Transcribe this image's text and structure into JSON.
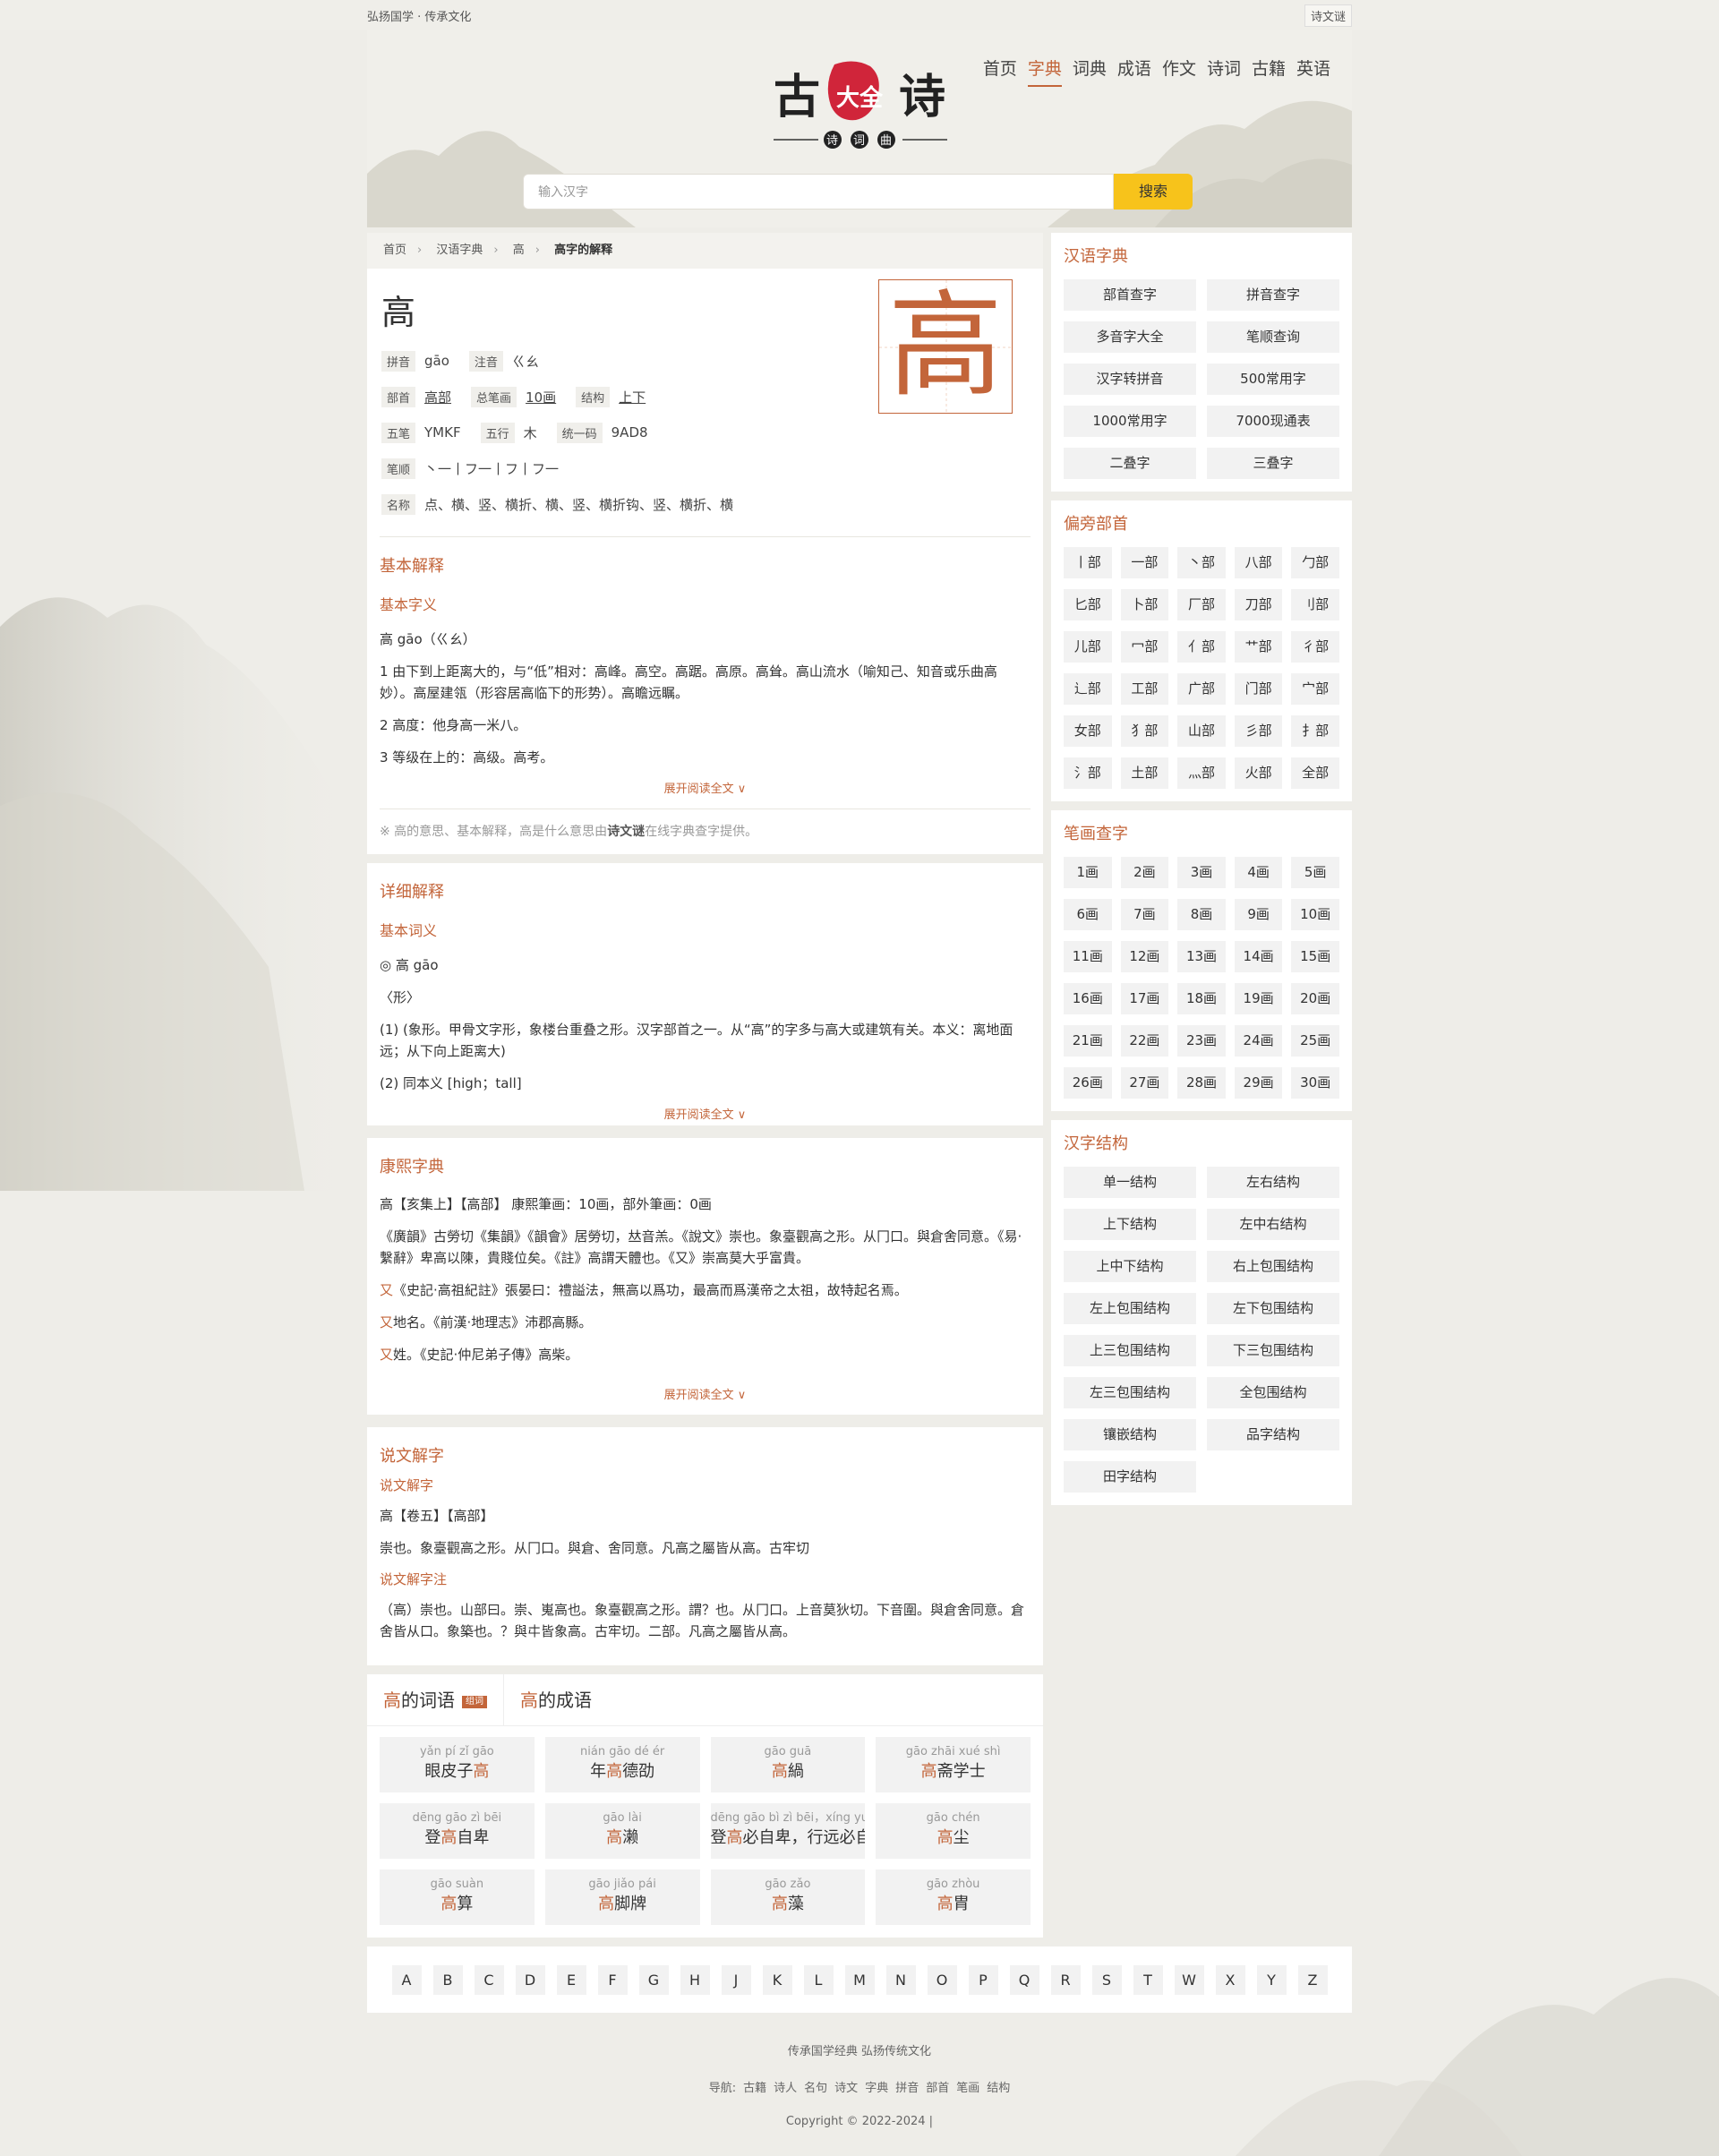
{
  "topbar": {
    "left": "弘扬国学 · 传承文化",
    "right": "诗文谜"
  },
  "nav": [
    "首页",
    "字典",
    "词典",
    "成语",
    "作文",
    "诗词",
    "古籍",
    "英语"
  ],
  "nav_active": 1,
  "logo": {
    "left": "古",
    "stamp": "大全",
    "right": "诗",
    "badges": [
      "诗",
      "词",
      "曲"
    ]
  },
  "search": {
    "placeholder": "输入汉字",
    "button": "搜索"
  },
  "breadcrumb": [
    "首页",
    "汉语字典",
    "高",
    "高字的解释"
  ],
  "char": {
    "glyph": "高",
    "rows": [
      [
        {
          "tag": "拼音",
          "val": "gāo"
        },
        {
          "tag": "注音",
          "val": "ㄍㄠ"
        }
      ],
      [
        {
          "tag": "部首",
          "val": "高部",
          "link": true
        },
        {
          "tag": "总笔画",
          "val": "10画",
          "link": true
        },
        {
          "tag": "结构",
          "val": "上下",
          "link": true
        }
      ],
      [
        {
          "tag": "五笔",
          "val": "YMKF"
        },
        {
          "tag": "五行",
          "val": "木"
        },
        {
          "tag": "统一码",
          "val": "9AD8"
        }
      ],
      [
        {
          "tag": "笔顺",
          "val": "丶一丨フ一丨フ丨フ一"
        }
      ],
      [
        {
          "tag": "名称",
          "val": "点、横、竖、横折、横、竖、横折钩、竖、横折、横"
        }
      ]
    ]
  },
  "basic": {
    "title": "基本解释",
    "subtitle": "基本字义",
    "head": "高 gāo（ㄍㄠ）",
    "items": [
      "1  由下到上距离大的，与“低”相对：高峰。高空。高踞。高原。高耸。高山流水（喻知己、知音或乐曲高妙）。高屋建瓴（形容居高临下的形势）。高瞻远瞩。",
      "2  高度：他身高一米八。",
      "3  等级在上的：高级。高考。"
    ],
    "more": "展开阅读全文 ∨",
    "note_pre": "※ 高的意思、基本解释，高是什么意思由",
    "note_brand": "诗文谜",
    "note_post": "在线字典查字提供。"
  },
  "detail": {
    "title": "详细解释",
    "subtitle": "基本词义",
    "head": "◎ 高 gāo",
    "pos": "〈形〉",
    "items": [
      "(1) (象形。甲骨文字形，象楼台重叠之形。汉字部首之一。从“高”的字多与高大或建筑有关。本义：离地面远；从下向上距离大)",
      "(2) 同本义 [high；tall]"
    ],
    "more": "展开阅读全文 ∨"
  },
  "kangxi": {
    "title": "康熙字典",
    "lines": [
      {
        "pre": "",
        "text": "高【亥集上】【高部】 康熙筆画：10画，部外筆画：0画"
      },
      {
        "pre": "",
        "text": "《廣韻》古勞切《集韻》《韻會》居勞切，𠀤音羔。《說文》崇也。象臺觀高之形。从冂口。與倉舍同意。《易·繫辭》卑高以陳，貴賤位矣。《註》高謂天體也。《又》崇高莫大乎富貴。"
      },
      {
        "pre": "又",
        "text": "《史記·高祖紀註》張晏曰：禮謚法，無高以爲功，最高而爲漢帝之太祖，故特起名焉。"
      },
      {
        "pre": "又",
        "text": "地名。《前漢·地理志》沛郡高縣。"
      },
      {
        "pre": "又",
        "text": "姓。《史記·仲尼弟子傳》高柴。"
      }
    ],
    "more": "展开阅读全文 ∨"
  },
  "shuowen": {
    "title": "说文解字",
    "sub1": "说文解字",
    "l1": "高【卷五】【高部】",
    "l2": "崇也。象臺觀高之形。从冂口。與倉、舍同意。凡高之屬皆从高。古牢切",
    "sub2": "说文解字注",
    "l3": "（高）崇也。山部曰。崇、嵬高也。象臺觀高之形。謂？也。从冂口。上音莫狄切。下音圍。與倉舍同意。倉舍皆从口。象築也。？與㐄皆象高。古牢切。二部。凡高之屬皆从高。"
  },
  "tabs": {
    "words_char": "高",
    "words_label": "的词语",
    "badge": "组词",
    "idioms_char": "高",
    "idioms_label": "的成语"
  },
  "words": [
    {
      "py": "yǎn pí zǐ gāo",
      "pre": "眼皮子",
      "hl": "高",
      "post": ""
    },
    {
      "py": "nián gāo dé ér",
      "pre": "年",
      "hl": "高",
      "post": "德劭"
    },
    {
      "py": "gāo guā",
      "pre": "",
      "hl": "高",
      "post": "緺"
    },
    {
      "py": "gāo zhāi xué shì",
      "pre": "",
      "hl": "高",
      "post": "斋学士"
    },
    {
      "py": "dēng gāo zì bēi",
      "pre": "登",
      "hl": "高",
      "post": "自卑"
    },
    {
      "py": "gāo lài",
      "pre": "",
      "hl": "高",
      "post": "濑"
    },
    {
      "py": "dēng gāo bì zì bēi，xíng yu",
      "pre": "登",
      "hl": "高",
      "post": "必自卑，行远必自"
    },
    {
      "py": "gāo chén",
      "pre": "",
      "hl": "高",
      "post": "尘"
    },
    {
      "py": "gāo suàn",
      "pre": "",
      "hl": "高",
      "post": "算"
    },
    {
      "py": "gāo jiǎo pái",
      "pre": "",
      "hl": "高",
      "post": "脚牌"
    },
    {
      "py": "gāo zǎo",
      "pre": "",
      "hl": "高",
      "post": "藻"
    },
    {
      "py": "gāo zhòu",
      "pre": "",
      "hl": "高",
      "post": "胄"
    }
  ],
  "alphabet": [
    "A",
    "B",
    "C",
    "D",
    "E",
    "F",
    "G",
    "H",
    "J",
    "K",
    "L",
    "M",
    "N",
    "O",
    "P",
    "Q",
    "R",
    "S",
    "T",
    "W",
    "X",
    "Y",
    "Z"
  ],
  "footer": {
    "slogan": "传承国学经典 弘扬传统文化",
    "nav_label": "导航:",
    "nav": [
      "古籍",
      "诗人",
      "名句",
      "诗文",
      "字典",
      "拼音",
      "部首",
      "笔画",
      "结构"
    ],
    "copyright": "Copyright © 2022-2024  |"
  },
  "side": {
    "dict": {
      "title": "汉语字典",
      "items": [
        "部首查字",
        "拼音查字",
        "多音字大全",
        "笔顺查询",
        "汉字转拼音",
        "500常用字",
        "1000常用字",
        "7000现通表",
        "二叠字",
        "三叠字"
      ]
    },
    "radicals": {
      "title": "偏旁部首",
      "items": [
        "丨部",
        "一部",
        "丶部",
        "八部",
        "勹部",
        "匕部",
        "卜部",
        "厂部",
        "刀部",
        "刂部",
        "儿部",
        "冖部",
        "亻部",
        "艹部",
        "彳部",
        "辶部",
        "工部",
        "广部",
        "门部",
        "宀部",
        "女部",
        "犭部",
        "山部",
        "彡部",
        "扌部",
        "氵部",
        "土部",
        "灬部",
        "火部",
        "全部"
      ]
    },
    "strokes": {
      "title": "笔画查字",
      "items": [
        "1画",
        "2画",
        "3画",
        "4画",
        "5画",
        "6画",
        "7画",
        "8画",
        "9画",
        "10画",
        "11画",
        "12画",
        "13画",
        "14画",
        "15画",
        "16画",
        "17画",
        "18画",
        "19画",
        "20画",
        "21画",
        "22画",
        "23画",
        "24画",
        "25画",
        "26画",
        "27画",
        "28画",
        "29画",
        "30画"
      ]
    },
    "structure": {
      "title": "汉字结构",
      "items": [
        "单一结构",
        "左右结构",
        "上下结构",
        "左中右结构",
        "上中下结构",
        "右上包围结构",
        "左上包围结构",
        "左下包围结构",
        "上三包围结构",
        "下三包围结构",
        "左三包围结构",
        "全包围结构",
        "镶嵌结构",
        "品字结构",
        "田字结构"
      ]
    }
  },
  "colors": {
    "accent": "#c3653a",
    "button": "#f7c31b",
    "page_bg": "#eeede8"
  }
}
